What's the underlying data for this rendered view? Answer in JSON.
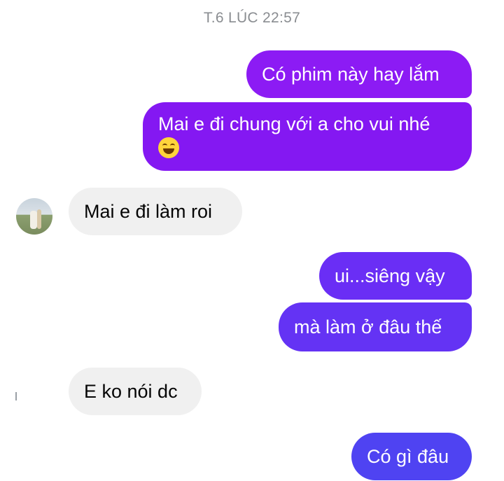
{
  "header": {
    "timestamp": "T.6 LÚC 22:57"
  },
  "messages": [
    {
      "direction": "outgoing",
      "text": "Có phim này hay lắm"
    },
    {
      "direction": "outgoing",
      "text": "Mai e đi chung với a cho vui nhé",
      "emoji": "smiling-face-icon"
    },
    {
      "direction": "incoming",
      "text": "Mai e đi làm roi"
    },
    {
      "direction": "outgoing",
      "text": "ui...siêng vậy"
    },
    {
      "direction": "outgoing",
      "text": "mà làm ở đâu thế"
    },
    {
      "direction": "incoming",
      "text": "E ko nói dc"
    },
    {
      "direction": "outgoing",
      "text": "Có gì đâu"
    }
  ],
  "colors": {
    "outgoing_top": "#8c1bf4",
    "outgoing_bottom": "#4f43f2",
    "incoming_bg": "#f0f0f0",
    "timestamp": "#8a8d91"
  }
}
